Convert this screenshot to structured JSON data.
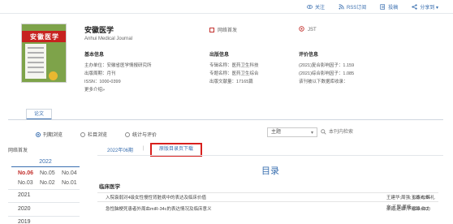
{
  "top_links": [
    {
      "label": "关注",
      "icon": "eye-icon"
    },
    {
      "label": "RSS订阅",
      "icon": "rss-icon"
    },
    {
      "label": "投稿",
      "icon": "submit-icon"
    },
    {
      "label": "分享到 ▾",
      "icon": "share-icon"
    }
  ],
  "journal": {
    "cover_text": "安徽医学",
    "title": "安徽医学",
    "subtitle": "Anhui Medical Journal"
  },
  "actions": {
    "pub_first": "网络首发",
    "jst": "JST"
  },
  "basic_info": {
    "heading": "基本信息",
    "rows": [
      "主办单位：安徽省医学情报研究所",
      "出版周期：月刊",
      "ISSN：1000-0399"
    ],
    "more": "更多介绍»"
  },
  "pub_info": {
    "heading": "出版信息",
    "rows": [
      "专辑名称：医药卫生科技",
      "专题名称：医药卫生综合",
      "出版文献量：17165篇"
    ]
  },
  "eval_info": {
    "heading": "评价信息",
    "rows": [
      "(2021)复合影响因子：1.159",
      "(2021)综合影响因子：1.085",
      "该刊被以下数据库收录："
    ]
  },
  "tab_label": "论文",
  "browse_modes": [
    {
      "label": "刊期浏览",
      "selected": true
    },
    {
      "label": "栏目浏览",
      "selected": false
    },
    {
      "label": "统计与评价",
      "selected": false
    }
  ],
  "search": {
    "field": "主题",
    "placeholder": "本刊内检索"
  },
  "left_panel": {
    "heading": "网络首发",
    "current_year": "2022",
    "issues": [
      {
        "label": "No.06",
        "selected": true
      },
      {
        "label": "No.05",
        "selected": false
      },
      {
        "label": "No.04",
        "selected": false
      },
      {
        "label": "No.03",
        "selected": false
      },
      {
        "label": "No.02",
        "selected": false
      },
      {
        "label": "No.01",
        "selected": false
      }
    ],
    "years": [
      "2021",
      "2020",
      "2019"
    ]
  },
  "content": {
    "crumb": "2022年06期",
    "crumb_sep": "|",
    "download": "原版目录页下载",
    "toc_title": "目录",
    "section": "临床医学",
    "articles": [
      {
        "title": "入院衰弱对4级女性慢性肾脏病中的表达及临床价值",
        "authors": "王建华;周强;王德光;韩礼文;王翠;董杨",
        "pages": "625-628"
      },
      {
        "title": "急性脑梗死患者外周血miR-34c的表达情况及临床意义",
        "authors": "梁霞;赵霖;华德锦;许力",
        "pages": "629-633"
      }
    ]
  },
  "colors": {
    "accent": "#3a6fb0",
    "highlight": "#d8201e",
    "cover_green": "#7ea34a",
    "cover_red": "#c7221f"
  }
}
